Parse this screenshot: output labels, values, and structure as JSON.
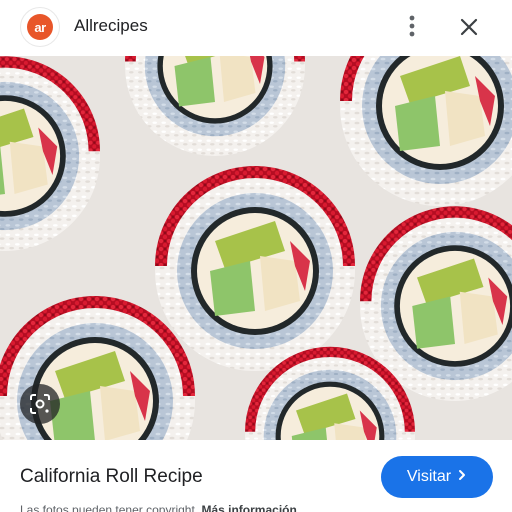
{
  "header": {
    "logo_text": "ar",
    "site_name": "Allrecipes",
    "more_icon": "more-vert-icon",
    "close_icon": "close-icon"
  },
  "image": {
    "subject": "california-roll-sushi-photo",
    "lens_icon": "google-lens-icon"
  },
  "footer": {
    "title": "California Roll Recipe",
    "visit_label": "Visitar",
    "visit_icon": "chevron-right-icon",
    "disclaimer": "Las fotos pueden tener copyright.",
    "more_info": "Más información"
  },
  "colors": {
    "accent": "#1a73e8",
    "logo": "#e8562a",
    "roe": "#c8102e"
  }
}
